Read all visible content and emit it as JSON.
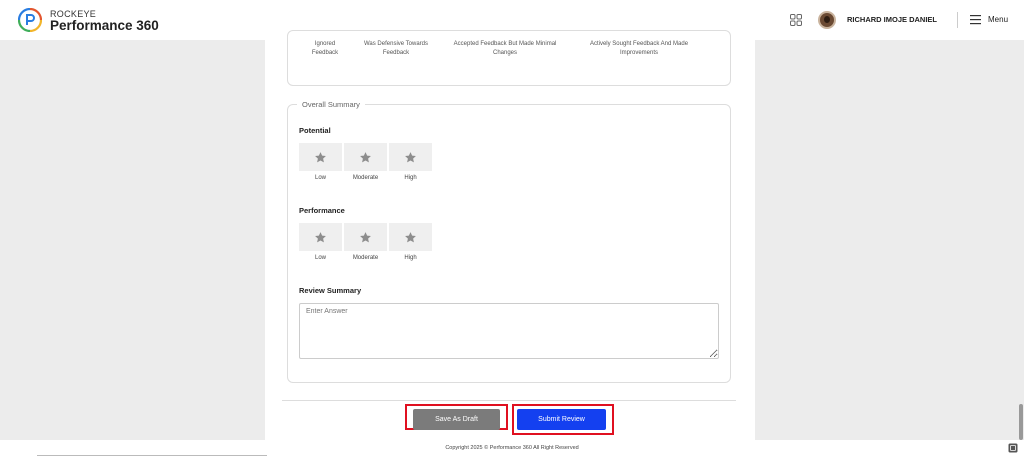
{
  "header": {
    "brand_top": "ROCKEYE",
    "brand_main": "Performance 360",
    "user_name": "RICHARD IMOJE DANIEL",
    "menu_label": "Menu",
    "icons": [
      "apps-grid-icon",
      "avatar",
      "hamburger-menu-icon"
    ]
  },
  "previous_scale": {
    "labels": [
      "Ignored\nFeedback",
      "Was Defensive Towards\nFeedback",
      "Accepted Feedback But Made Minimal\nChanges",
      "Actively Sought Feedback And Made\nImprovements"
    ]
  },
  "overall_summary": {
    "legend": "Overall Summary",
    "potential": {
      "title": "Potential",
      "options": [
        "Low",
        "Moderate",
        "High"
      ]
    },
    "performance": {
      "title": "Performance",
      "options": [
        "Low",
        "Moderate",
        "High"
      ]
    },
    "review_summary": {
      "title": "Review Summary",
      "placeholder": "Enter Answer",
      "value": ""
    }
  },
  "actions": {
    "save_draft": "Save As Draft",
    "submit_review": "Submit Review"
  },
  "footer": {
    "copyright": "Copyright 2025 © Performance 360 All Right Reserved"
  },
  "colors": {
    "submit": "#1440f0",
    "draft": "#7b7b7b",
    "highlight": "#e01020"
  }
}
